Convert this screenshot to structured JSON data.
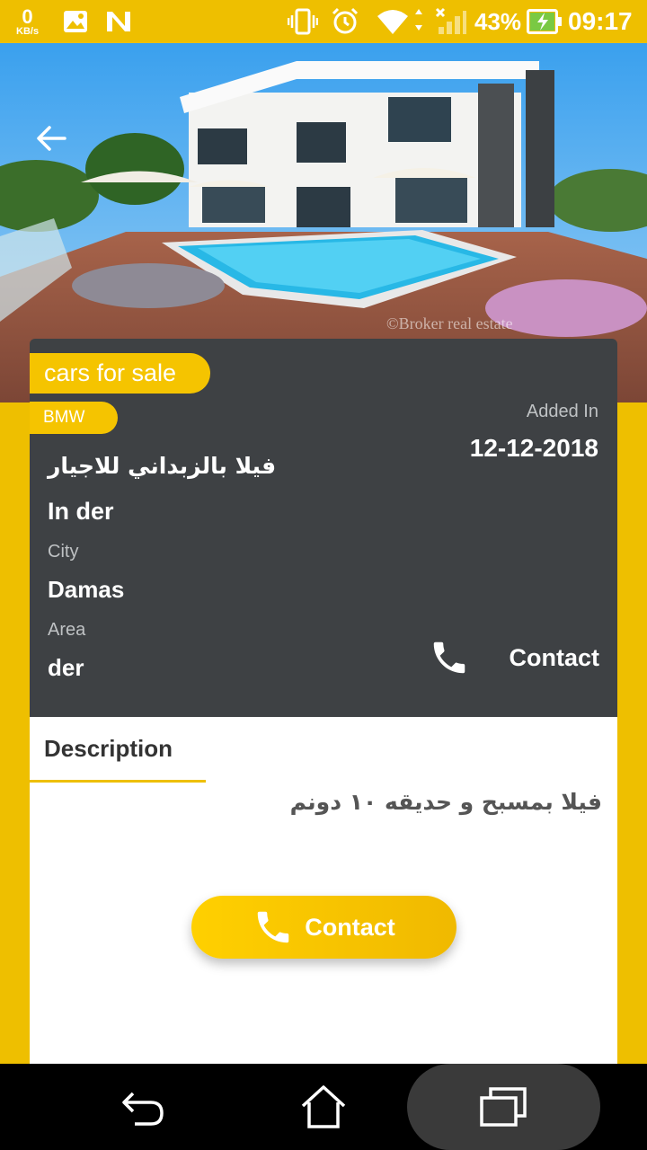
{
  "status_bar": {
    "speed_value": "0",
    "speed_unit": "KB/s",
    "battery": "43%",
    "time": "09:17",
    "icons": [
      "image-icon",
      "n-icon",
      "vibrate-icon",
      "alarm-icon",
      "wifi-icon",
      "signal-icon",
      "battery-charging-icon"
    ]
  },
  "hero": {
    "back_icon": "arrow-back-icon",
    "watermark": "©Broker real estate"
  },
  "listing": {
    "category": "cars for sale",
    "brand": "BMW",
    "added_label": "Added In",
    "added_date": "12-12-2018",
    "title_ar": "فيلا بالزبداني للاجيار",
    "name": "In der",
    "city_label": "City",
    "city": "Damas",
    "area_label": "Area",
    "area": "der",
    "contact_label": "Contact"
  },
  "details": {
    "tab_label": "Description",
    "description": "فيلا بمسبح و حديقه ١٠ دونم",
    "contact_button": "Contact"
  },
  "colors": {
    "accent": "#eebf00",
    "pill": "#f5c400",
    "card": "#3e4144"
  }
}
